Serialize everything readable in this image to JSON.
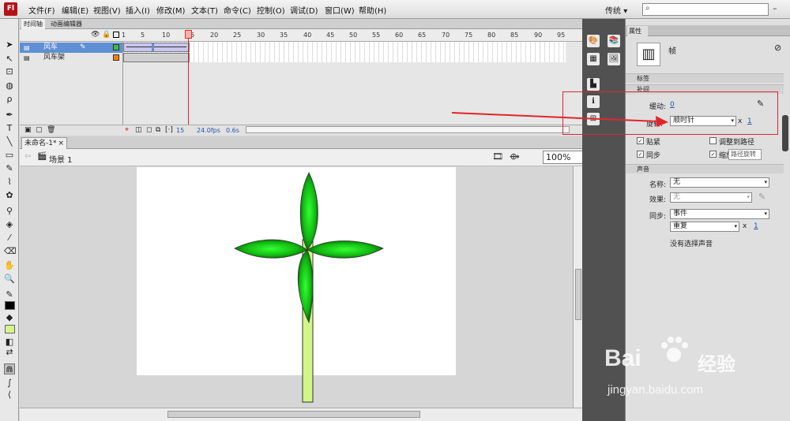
{
  "app": {
    "menu": [
      "文件(F)",
      "编辑(E)",
      "视图(V)",
      "插入(I)",
      "修改(M)",
      "文本(T)",
      "命令(C)",
      "控制(O)",
      "调试(D)",
      "窗口(W)",
      "帮助(H)"
    ],
    "logo_text": "Fl",
    "workspace": "传统",
    "workspace_arrow": "▾"
  },
  "timeline": {
    "tabs": [
      "时间轴",
      "动画编辑器"
    ],
    "ruler": [
      "1",
      "5",
      "10",
      "15",
      "20",
      "25",
      "30",
      "35",
      "40",
      "45",
      "50",
      "55",
      "60",
      "65",
      "70",
      "75",
      "80",
      "85",
      "90",
      "95"
    ],
    "layers": [
      {
        "name": "风车",
        "selected": true,
        "color": "#3ac43a"
      },
      {
        "name": "风车架",
        "selected": false,
        "color": "#ff7f00"
      }
    ],
    "playhead_frame": "15",
    "footer": {
      "frame": "15",
      "fps": "24.0fps",
      "time": "0.6s"
    }
  },
  "document": {
    "tab_label": "未命名-1*",
    "scene_label": "场景 1",
    "zoom": "100%"
  },
  "properties": {
    "tab_label": "属性",
    "frame_label": "帧",
    "sections": {
      "label": "标签",
      "tween": "补间",
      "sound": "声音"
    },
    "ease_label": "缓动:",
    "ease_value": "0",
    "rotate_label": "旋转:",
    "rotate_value": "顺时针",
    "rotate_times_x": "x",
    "rotate_times": "1",
    "snap_label": "贴紧",
    "orient_label": "调整到路径",
    "sync_label": "同步",
    "scale_label": "缩放",
    "tooltip": "路径旋转",
    "sound_name_label": "名称:",
    "sound_name_value": "无",
    "effect_label": "效果:",
    "effect_value": "无",
    "sync2_label": "同步:",
    "sync2_value": "事件",
    "repeat_value": "重复",
    "repeat_x": "x",
    "repeat_count": "1",
    "no_sound_text": "没有选择声音"
  },
  "watermark": {
    "text1": "Bai",
    "text2": "经验",
    "url": "jingyan.baidu.com"
  },
  "colors": {
    "accent_red": "#e0262b",
    "blade_green": "#11c311",
    "pole_green": "#d4f58a"
  }
}
